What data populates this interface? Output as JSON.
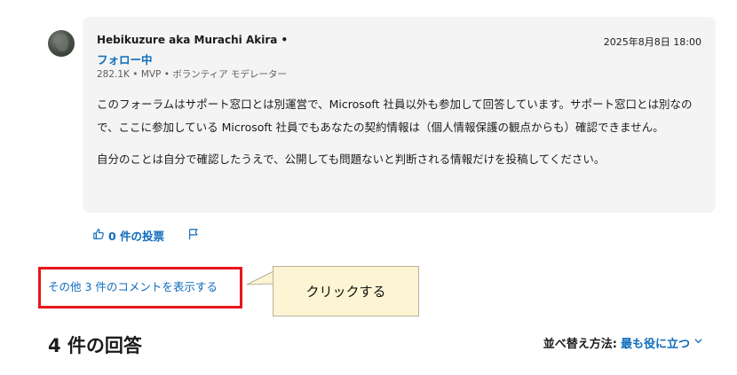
{
  "post": {
    "author": "Hebikuzure aka Murachi Akira •",
    "follow_label": "フォロー中",
    "meta": "282.1K • MVP • ボランティア モデレーター",
    "date": "2025年8月8日 18:00",
    "paragraphs": [
      "このフォーラムはサポート窓口とは別運営で、Microsoft 社員以外も参加して回答しています。サポート窓口とは別なので、ここに参加している Microsoft 社員でもあなたの契約情報は（個人情報保護の観点からも）確認できません。",
      "自分のことは自分で確認したうえで、公開しても問題ないと判断される情報だけを投稿してください。"
    ]
  },
  "actions": {
    "vote_label": "0 件の投票"
  },
  "comments": {
    "show_more_label": "その他 3 件のコメントを表示する"
  },
  "callout": {
    "text": "クリックする"
  },
  "answers": {
    "title": "4 件の回答",
    "sort_label": "並べ替え方法:",
    "sort_value": "最も役に立つ"
  },
  "colors": {
    "link": "#0f6cbd",
    "highlight_border": "#e8151c",
    "callout_bg": "#fdf4d3",
    "card_bg": "#f4f4f4"
  },
  "icons": [
    "thumbs-up-icon",
    "flag-icon",
    "chevron-down-icon"
  ]
}
